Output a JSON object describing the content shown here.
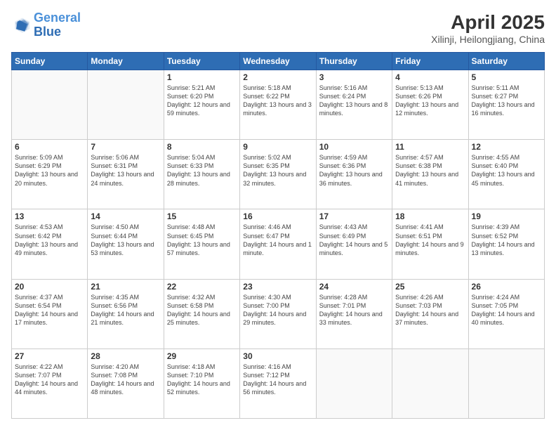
{
  "header": {
    "logo_line1": "General",
    "logo_line2": "Blue",
    "title": "April 2025",
    "subtitle": "Xilinji, Heilongjiang, China"
  },
  "days_of_week": [
    "Sunday",
    "Monday",
    "Tuesday",
    "Wednesday",
    "Thursday",
    "Friday",
    "Saturday"
  ],
  "weeks": [
    [
      {
        "day": "",
        "info": ""
      },
      {
        "day": "",
        "info": ""
      },
      {
        "day": "1",
        "info": "Sunrise: 5:21 AM\nSunset: 6:20 PM\nDaylight: 12 hours and 59 minutes."
      },
      {
        "day": "2",
        "info": "Sunrise: 5:18 AM\nSunset: 6:22 PM\nDaylight: 13 hours and 3 minutes."
      },
      {
        "day": "3",
        "info": "Sunrise: 5:16 AM\nSunset: 6:24 PM\nDaylight: 13 hours and 8 minutes."
      },
      {
        "day": "4",
        "info": "Sunrise: 5:13 AM\nSunset: 6:26 PM\nDaylight: 13 hours and 12 minutes."
      },
      {
        "day": "5",
        "info": "Sunrise: 5:11 AM\nSunset: 6:27 PM\nDaylight: 13 hours and 16 minutes."
      }
    ],
    [
      {
        "day": "6",
        "info": "Sunrise: 5:09 AM\nSunset: 6:29 PM\nDaylight: 13 hours and 20 minutes."
      },
      {
        "day": "7",
        "info": "Sunrise: 5:06 AM\nSunset: 6:31 PM\nDaylight: 13 hours and 24 minutes."
      },
      {
        "day": "8",
        "info": "Sunrise: 5:04 AM\nSunset: 6:33 PM\nDaylight: 13 hours and 28 minutes."
      },
      {
        "day": "9",
        "info": "Sunrise: 5:02 AM\nSunset: 6:35 PM\nDaylight: 13 hours and 32 minutes."
      },
      {
        "day": "10",
        "info": "Sunrise: 4:59 AM\nSunset: 6:36 PM\nDaylight: 13 hours and 36 minutes."
      },
      {
        "day": "11",
        "info": "Sunrise: 4:57 AM\nSunset: 6:38 PM\nDaylight: 13 hours and 41 minutes."
      },
      {
        "day": "12",
        "info": "Sunrise: 4:55 AM\nSunset: 6:40 PM\nDaylight: 13 hours and 45 minutes."
      }
    ],
    [
      {
        "day": "13",
        "info": "Sunrise: 4:53 AM\nSunset: 6:42 PM\nDaylight: 13 hours and 49 minutes."
      },
      {
        "day": "14",
        "info": "Sunrise: 4:50 AM\nSunset: 6:44 PM\nDaylight: 13 hours and 53 minutes."
      },
      {
        "day": "15",
        "info": "Sunrise: 4:48 AM\nSunset: 6:45 PM\nDaylight: 13 hours and 57 minutes."
      },
      {
        "day": "16",
        "info": "Sunrise: 4:46 AM\nSunset: 6:47 PM\nDaylight: 14 hours and 1 minute."
      },
      {
        "day": "17",
        "info": "Sunrise: 4:43 AM\nSunset: 6:49 PM\nDaylight: 14 hours and 5 minutes."
      },
      {
        "day": "18",
        "info": "Sunrise: 4:41 AM\nSunset: 6:51 PM\nDaylight: 14 hours and 9 minutes."
      },
      {
        "day": "19",
        "info": "Sunrise: 4:39 AM\nSunset: 6:52 PM\nDaylight: 14 hours and 13 minutes."
      }
    ],
    [
      {
        "day": "20",
        "info": "Sunrise: 4:37 AM\nSunset: 6:54 PM\nDaylight: 14 hours and 17 minutes."
      },
      {
        "day": "21",
        "info": "Sunrise: 4:35 AM\nSunset: 6:56 PM\nDaylight: 14 hours and 21 minutes."
      },
      {
        "day": "22",
        "info": "Sunrise: 4:32 AM\nSunset: 6:58 PM\nDaylight: 14 hours and 25 minutes."
      },
      {
        "day": "23",
        "info": "Sunrise: 4:30 AM\nSunset: 7:00 PM\nDaylight: 14 hours and 29 minutes."
      },
      {
        "day": "24",
        "info": "Sunrise: 4:28 AM\nSunset: 7:01 PM\nDaylight: 14 hours and 33 minutes."
      },
      {
        "day": "25",
        "info": "Sunrise: 4:26 AM\nSunset: 7:03 PM\nDaylight: 14 hours and 37 minutes."
      },
      {
        "day": "26",
        "info": "Sunrise: 4:24 AM\nSunset: 7:05 PM\nDaylight: 14 hours and 40 minutes."
      }
    ],
    [
      {
        "day": "27",
        "info": "Sunrise: 4:22 AM\nSunset: 7:07 PM\nDaylight: 14 hours and 44 minutes."
      },
      {
        "day": "28",
        "info": "Sunrise: 4:20 AM\nSunset: 7:08 PM\nDaylight: 14 hours and 48 minutes."
      },
      {
        "day": "29",
        "info": "Sunrise: 4:18 AM\nSunset: 7:10 PM\nDaylight: 14 hours and 52 minutes."
      },
      {
        "day": "30",
        "info": "Sunrise: 4:16 AM\nSunset: 7:12 PM\nDaylight: 14 hours and 56 minutes."
      },
      {
        "day": "",
        "info": ""
      },
      {
        "day": "",
        "info": ""
      },
      {
        "day": "",
        "info": ""
      }
    ]
  ]
}
